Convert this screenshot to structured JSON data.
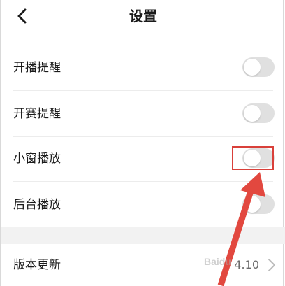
{
  "header": {
    "title": "设置",
    "back_icon": "chevron-left-icon"
  },
  "settings": [
    {
      "label": "开播提醒",
      "toggle_on": false
    },
    {
      "label": "开赛提醒",
      "toggle_on": false
    },
    {
      "label": "小窗播放",
      "toggle_on": false,
      "highlighted": true
    },
    {
      "label": "后台播放",
      "toggle_on": false
    }
  ],
  "version_row": {
    "label": "版本更新",
    "value": "4.10",
    "chevron_icon": "chevron-right-icon"
  },
  "annotation": {
    "highlight_color": "#d9403a",
    "arrow_color": "#e2483f"
  },
  "watermark": {
    "text": "Baidu"
  },
  "colors": {
    "toggle_off": "#e0e0e0",
    "divider": "#ececec",
    "section_gap": "#f2f2f2"
  }
}
